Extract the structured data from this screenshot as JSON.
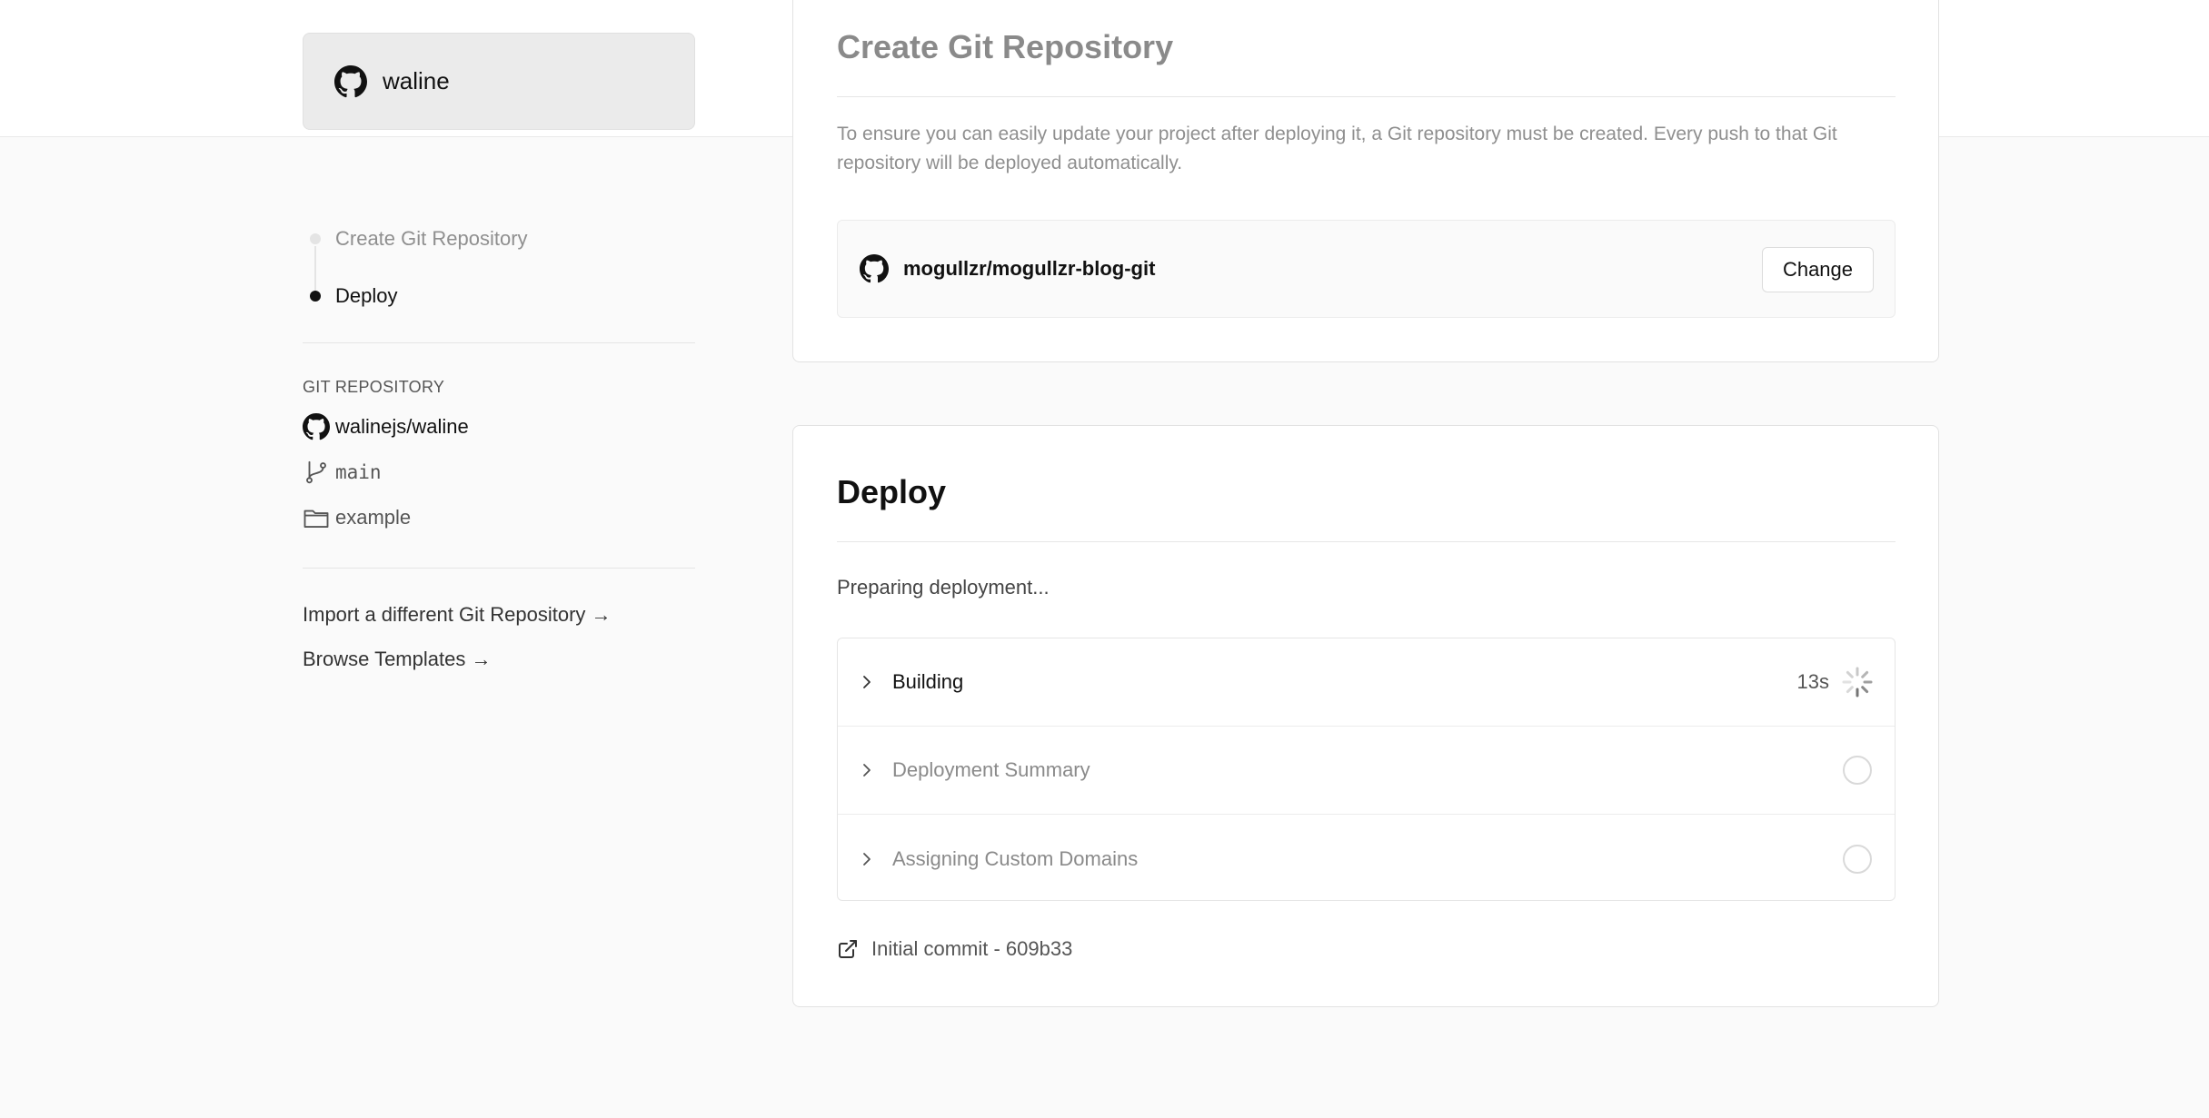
{
  "project": {
    "name": "waline"
  },
  "steps": [
    {
      "label": "Create Git Repository",
      "state": "done"
    },
    {
      "label": "Deploy",
      "state": "active"
    }
  ],
  "git": {
    "heading": "GIT REPOSITORY",
    "repo": "walinejs/waline",
    "branch": "main",
    "directory": "example"
  },
  "links": {
    "import_other": "Import a different Git Repository →",
    "browse_templates": "Browse Templates →"
  },
  "create_repo": {
    "title": "Create Git Repository",
    "description": "To ensure you can easily update your project after deploying it, a Git repository must be created. Every push to that Git repository will be deployed automatically.",
    "repo_name": "mogullzr/mogullzr-blog-git",
    "change_label": "Change"
  },
  "deploy": {
    "title": "Deploy",
    "status": "Preparing deployment...",
    "rows": [
      {
        "label": "Building",
        "time": "13s",
        "state": "running"
      },
      {
        "label": "Deployment Summary",
        "state": "pending"
      },
      {
        "label": "Assigning Custom Domains",
        "state": "pending"
      }
    ],
    "commit": "Initial commit - 609b33"
  },
  "colors": {
    "accent": "#111111",
    "muted": "#8f8f8f",
    "border": "#e2e2e2"
  }
}
